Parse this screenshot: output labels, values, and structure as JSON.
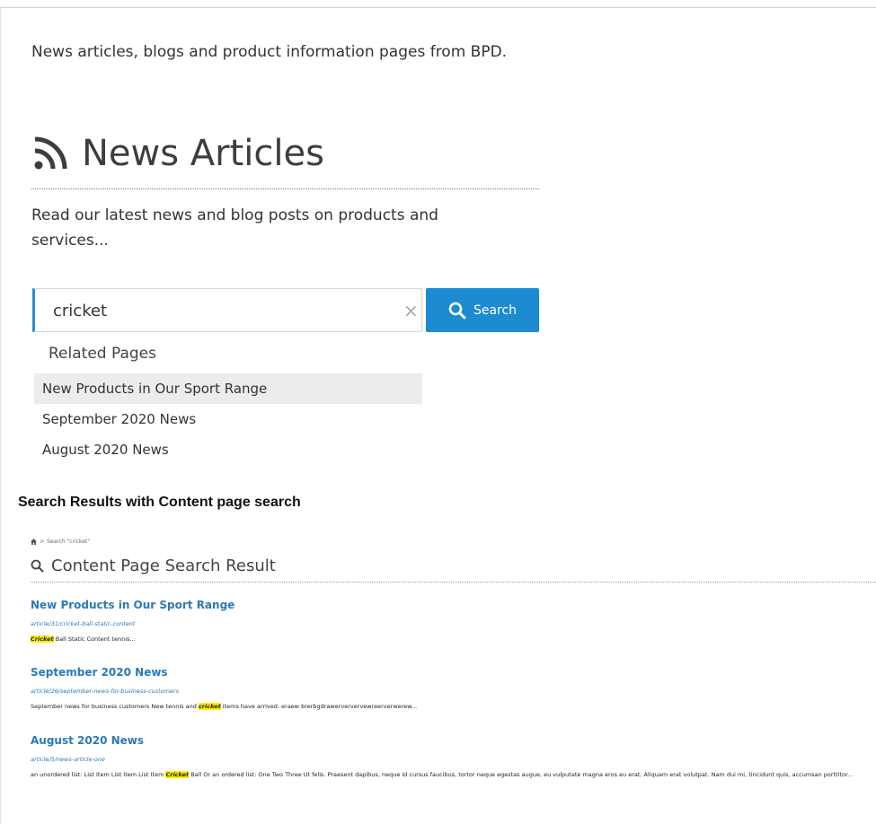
{
  "intro": "News articles, blogs and product information pages from BPD.",
  "news": {
    "title": "News Articles",
    "subtitle": "Read our latest news and blog posts on products and services..."
  },
  "search": {
    "value": "cricket",
    "clear_symbol": "×",
    "button_label": "Search"
  },
  "related": {
    "heading": "Related Pages",
    "items": [
      "New Products in Our Sport Range",
      "September 2020 News",
      "August 2020 News"
    ]
  },
  "section_label": "Search Results with Content page search",
  "breadcrumb": {
    "separator": ">",
    "current": "Search \"cricket\""
  },
  "results_title": "Content Page Search Result",
  "results": [
    {
      "title": "New Products in Our Sport Range",
      "url": "article/31/cricket-ball-static-content",
      "pre": "",
      "highlight": "Cricket",
      "post": " Ball Static Content tennis..."
    },
    {
      "title": "September 2020 News",
      "url": "article/26/september-news-for-business-customers",
      "pre": "September news for business customers New tennis and ",
      "highlight": "cricket",
      "post": " items have arrived. eraew brerbgdrawerververvewreerverwerew..."
    },
    {
      "title": "August 2020 News",
      "url": "article/5/news-article-one",
      "pre": "an unordered list: List Item List Item List Item ",
      "highlight": "Cricket",
      "post": " Ball Or an ordered list:  One  Two Three Ut felis. Praesent dapibus, neque id cursus faucibus, tortor neque egestas augue, eu vulputate magna eros eu erat. Aliquam erat volutpat. Nam dui mi, tincidunt quis, accumsan porttitor..."
    }
  ],
  "colors": {
    "accent": "#1c8bd1",
    "link": "#2a7ab8",
    "highlight": "#ffee00"
  }
}
